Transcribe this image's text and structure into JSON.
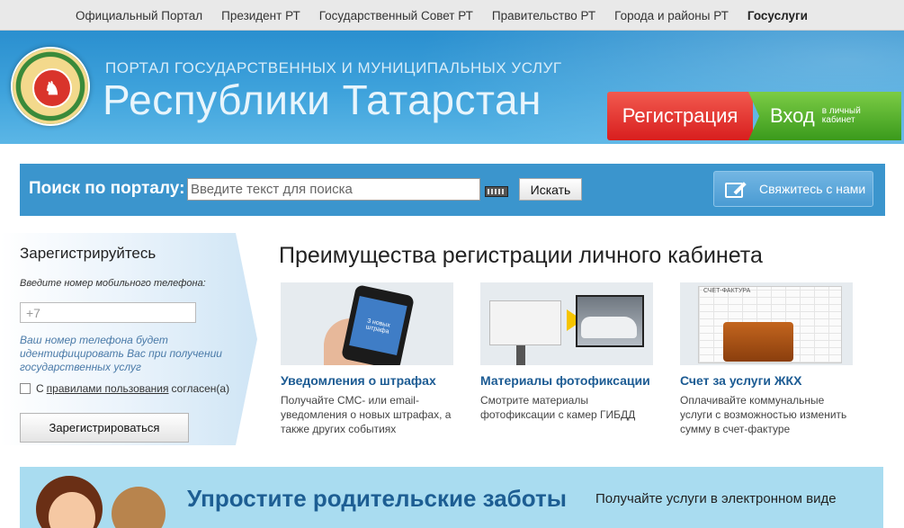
{
  "topnav": {
    "items": [
      {
        "label": "Официальный Портал"
      },
      {
        "label": "Президент РТ"
      },
      {
        "label": "Государственный Совет РТ"
      },
      {
        "label": "Правительство РТ"
      },
      {
        "label": "Города и районы РТ"
      },
      {
        "label": "Госуслуги"
      }
    ]
  },
  "header": {
    "subtitle": "ПОРТАЛ ГОСУДАРСТВЕННЫХ И МУНИЦИПАЛЬНЫХ УСЛУГ",
    "title": "Республики Татарстан",
    "register_label": "Регистрация",
    "login_label": "Вход",
    "login_sub": "в личный кабинет"
  },
  "search": {
    "label": "Поиск по порталу:",
    "placeholder": "Введите текст для поиска",
    "button": "Искать",
    "contact": "Свяжитесь с нами"
  },
  "register": {
    "title": "Зарегистрируйтесь",
    "phone_label": "Введите номер мобильного телефона:",
    "phone_value": "+7",
    "note": "Ваш номер телефона будет идентифицировать Вас при получении государственных услуг",
    "agree_prefix": "С",
    "agree_link": "правилами пользования",
    "agree_suffix": "согласен(а)",
    "button": "Зарегистрироваться"
  },
  "benefits": {
    "title": "Преимущества регистрации личного кабинета",
    "cards": [
      {
        "title": "Уведомления о штрафах",
        "desc": "Получайте СМС- или email-уведомления о новых штрафах, а также других событиях",
        "image_text": "3 новых штрафа"
      },
      {
        "title": "Материалы фотофиксации",
        "desc": "Смотрите материалы фотофиксации с камер ГИБДД"
      },
      {
        "title": "Счет за услуги ЖКХ",
        "desc": "Оплачивайте коммунальные услуги с возможностью изменить сумму в счет-фактуре",
        "image_text": "СЧЕТ-ФАКТУРА"
      }
    ]
  },
  "banner": {
    "title": "Упростите родительские заботы",
    "subtitle": "Получайте услуги в электронном виде"
  },
  "colors": {
    "header_blue": "#3fa3dc",
    "register_red": "#d81e1e",
    "login_green": "#3a9a1c",
    "search_bar": "#3b95cd",
    "link_blue": "#1c5b93"
  }
}
